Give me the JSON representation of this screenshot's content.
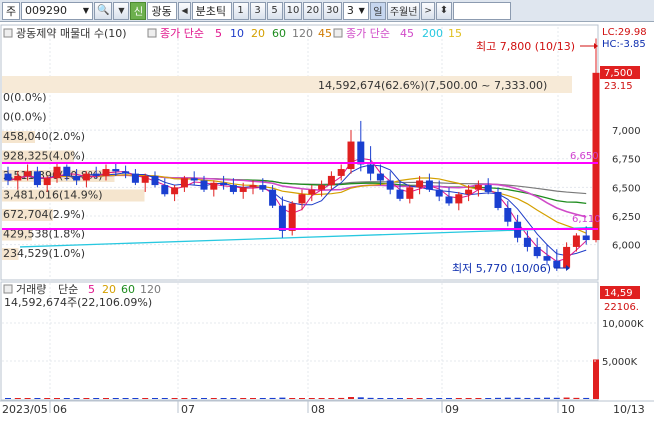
{
  "toolbar": {
    "market": "주",
    "code": "009290",
    "sin_label": "신",
    "stock_short": "광동",
    "mode_label": "분초틱",
    "intervals": [
      "1",
      "3",
      "5",
      "10",
      "20",
      "30"
    ],
    "interval_select": "3",
    "day_label": "일",
    "week_month_label": "주월년"
  },
  "legend": {
    "title": "광동제약 매물대 수(10)",
    "ma_label": "종가 단순",
    "ma_periods": [
      "5",
      "10",
      "20",
      "60",
      "120"
    ],
    "ma_colors": [
      "#e0148c",
      "#1e3cc8",
      "#d4a000",
      "#1e8c1e",
      "#7a7a7a"
    ],
    "ma2_label": "종가 단순",
    "ma2_periods": [
      "45",
      "200",
      "15"
    ],
    "ma2_colors": [
      "#d04ac8",
      "#28c8e0",
      "#e0c020"
    ],
    "ma_first_45": "45"
  },
  "price_panel": {
    "max_label": "최고 7,800 (10/13)",
    "min_label": "최저 5,770 (10/06)",
    "info_bar": "14,592,674(62.6%)(7,500.00 ~ 7,333.00)",
    "lc_label": "LC:29.98",
    "hc_label": "HC:-3.85",
    "current_price": "7,500",
    "current_change": "23.15",
    "line_label_1": "6,650",
    "line_label_2": "6,110",
    "volume_profile": [
      "0(0.0%)",
      "0(0.0%)",
      "458,040(2.0%)",
      "928,325(4.0%)",
      "2,511,390(10.8%)",
      "3,481,016(14.9%)",
      "672,704(2.9%)",
      "429,538(1.8%)",
      "234,529(1.0%)"
    ],
    "y_ticks": [
      "7,000",
      "6,750",
      "6,500",
      "6,250",
      "6,000"
    ]
  },
  "volume_panel": {
    "title": "거래량",
    "ma_label": "단순",
    "ma_periods": [
      "5",
      "20",
      "60",
      "120"
    ],
    "value_label": "14,592,674주(22,106.09%)",
    "current_badge": "14,59",
    "current_pct": "22106.",
    "y_ticks": [
      "10,000K",
      "5,000K"
    ]
  },
  "x_axis": {
    "labels": [
      "2023/05",
      "06",
      "07",
      "08",
      "09",
      "10",
      "10/13"
    ]
  },
  "chart_data": {
    "type": "candlestick",
    "y_range": [
      5700,
      7900
    ],
    "ohlc": [
      [
        6620,
        6680,
        6520,
        6560
      ],
      [
        6560,
        6640,
        6480,
        6600
      ],
      [
        6600,
        6700,
        6560,
        6640
      ],
      [
        6640,
        6680,
        6500,
        6520
      ],
      [
        6520,
        6600,
        6460,
        6580
      ],
      [
        6580,
        6720,
        6540,
        6680
      ],
      [
        6680,
        6700,
        6560,
        6600
      ],
      [
        6600,
        6660,
        6520,
        6560
      ],
      [
        6560,
        6640,
        6500,
        6620
      ],
      [
        6620,
        6680,
        6580,
        6600
      ],
      [
        6600,
        6700,
        6560,
        6660
      ],
      [
        6660,
        6720,
        6600,
        6640
      ],
      [
        6640,
        6690,
        6580,
        6620
      ],
      [
        6620,
        6660,
        6520,
        6540
      ],
      [
        6540,
        6620,
        6460,
        6600
      ],
      [
        6600,
        6640,
        6500,
        6520
      ],
      [
        6520,
        6580,
        6420,
        6440
      ],
      [
        6440,
        6520,
        6380,
        6500
      ],
      [
        6500,
        6600,
        6460,
        6580
      ],
      [
        6580,
        6640,
        6520,
        6560
      ],
      [
        6560,
        6600,
        6460,
        6480
      ],
      [
        6480,
        6560,
        6420,
        6540
      ],
      [
        6540,
        6600,
        6480,
        6520
      ],
      [
        6520,
        6580,
        6440,
        6460
      ],
      [
        6460,
        6540,
        6400,
        6500
      ],
      [
        6500,
        6560,
        6440,
        6520
      ],
      [
        6520,
        6580,
        6460,
        6480
      ],
      [
        6480,
        6520,
        6320,
        6340
      ],
      [
        6340,
        6420,
        6060,
        6120
      ],
      [
        6120,
        6380,
        6080,
        6360
      ],
      [
        6360,
        6480,
        6300,
        6440
      ],
      [
        6440,
        6520,
        6380,
        6480
      ],
      [
        6480,
        6560,
        6420,
        6520
      ],
      [
        6520,
        6640,
        6480,
        6600
      ],
      [
        6600,
        6700,
        6560,
        6660
      ],
      [
        6660,
        7000,
        6620,
        6900
      ],
      [
        6900,
        7080,
        6640,
        6700
      ],
      [
        6700,
        6860,
        6560,
        6620
      ],
      [
        6620,
        6700,
        6520,
        6560
      ],
      [
        6560,
        6640,
        6440,
        6480
      ],
      [
        6480,
        6560,
        6380,
        6400
      ],
      [
        6400,
        6520,
        6360,
        6500
      ],
      [
        6500,
        6600,
        6440,
        6560
      ],
      [
        6560,
        6620,
        6460,
        6480
      ],
      [
        6480,
        6560,
        6380,
        6420
      ],
      [
        6420,
        6500,
        6340,
        6360
      ],
      [
        6360,
        6460,
        6300,
        6440
      ],
      [
        6440,
        6520,
        6380,
        6480
      ],
      [
        6480,
        6560,
        6420,
        6520
      ],
      [
        6520,
        6580,
        6440,
        6460
      ],
      [
        6460,
        6500,
        6300,
        6320
      ],
      [
        6320,
        6380,
        6160,
        6200
      ],
      [
        6200,
        6260,
        6020,
        6060
      ],
      [
        6060,
        6120,
        5940,
        5980
      ],
      [
        5980,
        6060,
        5880,
        5900
      ],
      [
        5900,
        6000,
        5820,
        5860
      ],
      [
        5860,
        5960,
        5770,
        5800
      ],
      [
        5800,
        6020,
        5780,
        5980
      ],
      [
        5980,
        6100,
        5940,
        6080
      ],
      [
        6080,
        6160,
        6000,
        6040
      ],
      [
        6040,
        7800,
        6020,
        7500
      ]
    ],
    "volume": [
      120,
      90,
      110,
      100,
      95,
      130,
      100,
      85,
      90,
      80,
      110,
      100,
      90,
      85,
      95,
      100,
      120,
      90,
      100,
      80,
      90,
      85,
      95,
      100,
      90,
      85,
      95,
      140,
      180,
      130,
      100,
      90,
      95,
      110,
      140,
      260,
      220,
      150,
      120,
      110,
      100,
      95,
      90,
      100,
      110,
      105,
      95,
      90,
      100,
      120,
      150,
      170,
      160,
      140,
      150,
      170,
      160,
      190,
      150,
      140,
      5200
    ],
    "volume_range": [
      0,
      15000
    ]
  }
}
